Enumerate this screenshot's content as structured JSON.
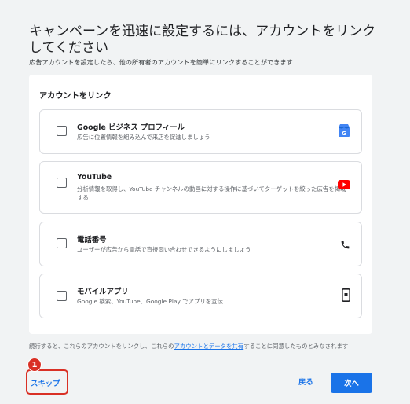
{
  "header": {
    "title": "キャンペーンを迅速に設定するには、アカウントをリンクしてください",
    "subtitle": "広告アカウントを設定したら、他の所有者のアカウントを簡単にリンクすることができます"
  },
  "card": {
    "title": "アカウントをリンク",
    "options": [
      {
        "title": "Google ビジネス プロフィール",
        "description": "広告に位置情報を組み込んで来店を促進しましょう",
        "icon": "google-business-profile-icon",
        "checked": false
      },
      {
        "title": "YouTube",
        "description": "分析情報を取得し、YouTube チャンネルの動画に対する操作に基づいてターゲットを絞った広告を掲載する",
        "icon": "youtube-icon",
        "checked": false
      },
      {
        "title": "電話番号",
        "description": "ユーザーが広告から電話で直接問い合わせできるようにしましょう",
        "icon": "phone-icon",
        "checked": false
      },
      {
        "title": "モバイルアプリ",
        "description": "Google 検索、YouTube、Google Play でアプリを宣伝",
        "icon": "mobile-app-icon",
        "checked": false
      }
    ]
  },
  "consent": {
    "before": "続行すると、これらのアカウントをリンクし、これらの",
    "link": "アカウントとデータを共有",
    "after": "することに同意したものとみなされます"
  },
  "footer": {
    "skip_label": "スキップ",
    "step_number": "1",
    "back_label": "戻る",
    "next_label": "次へ"
  },
  "colors": {
    "accent": "#1a73e8",
    "highlight": "#d93025",
    "youtube": "#ff0000",
    "background": "#f1f3f4"
  }
}
